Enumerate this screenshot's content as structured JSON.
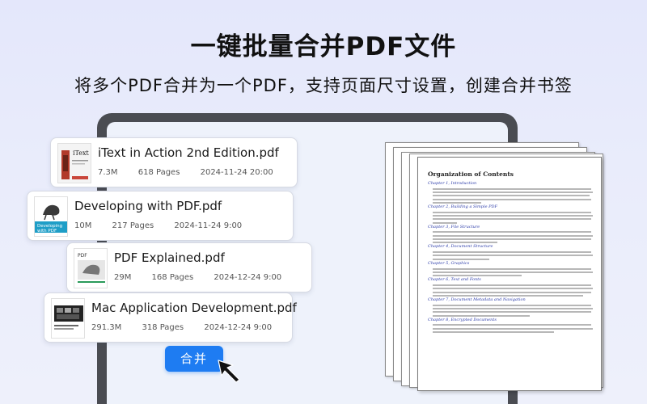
{
  "headline": "一键批量合并PDF文件",
  "subline": "将多个PDF合并为一个PDF，支持页面尺寸设置，创建合并书签",
  "files": [
    {
      "name": "iText in Action 2nd Edition.pdf",
      "size": "7.3M",
      "pages": "618 Pages",
      "date": "2024-11-24 20:00"
    },
    {
      "name": "Developing with PDF.pdf",
      "size": "10M",
      "pages": "217 Pages",
      "date": "2024-11-24 9:00"
    },
    {
      "name": "PDF Explained.pdf",
      "size": "29M",
      "pages": "168 Pages",
      "date": "2024-12-24 9:00"
    },
    {
      "name": "Mac Application Development.pdf",
      "size": "291.3M",
      "pages": "318 Pages",
      "date": "2024-12-24 9:00"
    }
  ],
  "merge_button": "合并",
  "document": {
    "title": "Organization of Contents",
    "chapters": [
      "Chapter 1, Introduction",
      "Chapter 2, Building a Simple PDF",
      "Chapter 3, File Structure",
      "Chapter 4, Document Structure",
      "Chapter 5, Graphics",
      "Chapter 6, Text and Fonts",
      "Chapter 7, Document Metadata and Navigation",
      "Chapter 8, Encrypted Documents"
    ]
  },
  "colors": {
    "accent": "#1e7cf2",
    "background": "#e8ebfb",
    "tablet": "#4a4c52"
  }
}
